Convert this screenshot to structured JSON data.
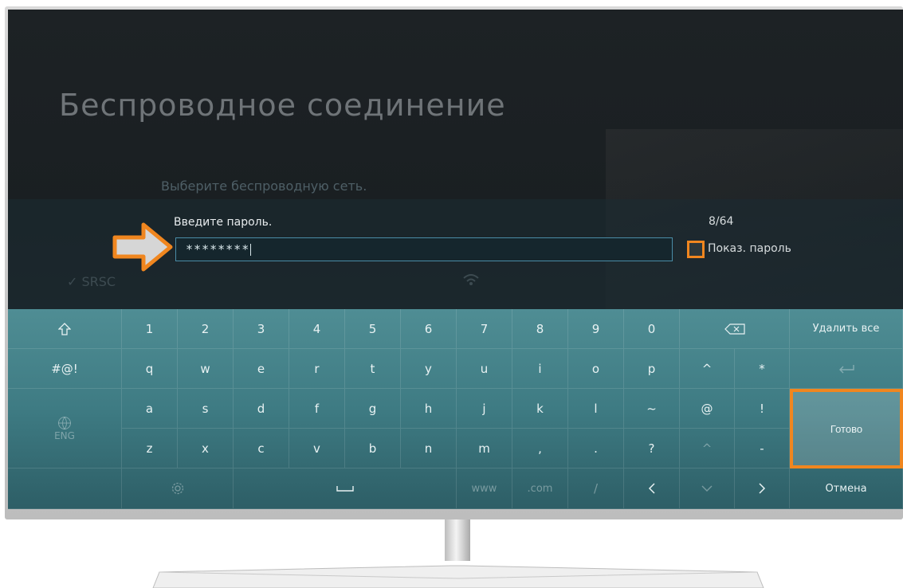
{
  "screen": {
    "title": "Беспроводное соединение",
    "subtitle": "Выберите беспроводную сеть.",
    "network_name": "SRSC"
  },
  "password": {
    "label": "Введите пароль.",
    "value": "********",
    "counter": "8/64",
    "show_password_label": "Показ. пароль",
    "show_password_checked": false
  },
  "keyboard": {
    "rows": [
      [
        "1",
        "2",
        "3",
        "4",
        "5",
        "6",
        "7",
        "8",
        "9",
        "0"
      ],
      [
        "q",
        "w",
        "e",
        "r",
        "t",
        "y",
        "u",
        "i",
        "o",
        "p",
        "^",
        "*"
      ],
      [
        "a",
        "s",
        "d",
        "f",
        "g",
        "h",
        "j",
        "k",
        "l",
        "~",
        "@",
        "!"
      ],
      [
        "z",
        "x",
        "c",
        "v",
        "b",
        "n",
        "m",
        ",",
        ".",
        "?",
        "^",
        "-"
      ],
      [
        "www",
        ".com",
        "/"
      ]
    ],
    "symbols_key": "#@!",
    "language_label": "ENG",
    "delete_all": "Удалить все",
    "done": "Готово",
    "cancel": "Отмена"
  },
  "colors": {
    "highlight": "#f0861f",
    "keyboard": "#4a8790"
  }
}
